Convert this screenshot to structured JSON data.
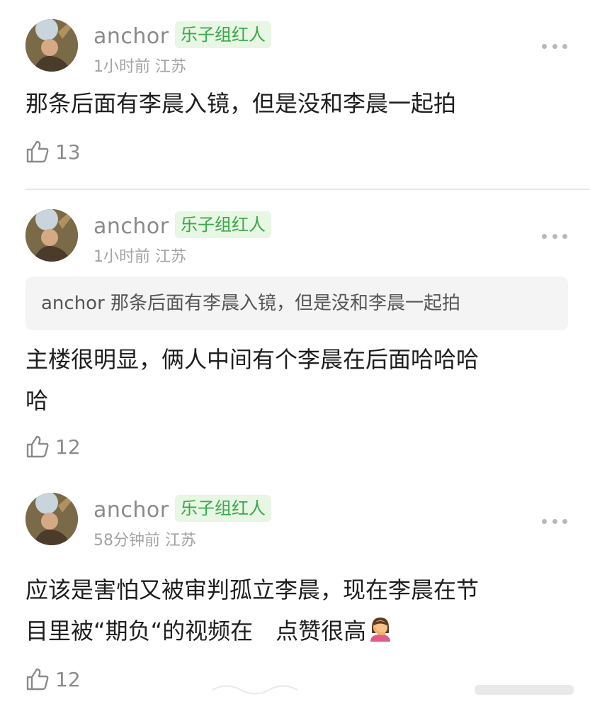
{
  "comments": [
    {
      "username": "anchor",
      "badge": "乐子组红人",
      "meta": "1小时前 江苏",
      "text": "那条后面有李晨入镜，但是没和李晨一起拍",
      "likes": "13"
    },
    {
      "username": "anchor",
      "badge": "乐子组红人",
      "meta": "1小时前 江苏",
      "quote": "anchor 那条后面有李晨入镜，但是没和李晨一起拍",
      "text_line1": "主楼很明显，俩人中间有个李晨在后面哈哈哈",
      "text_line2": "哈",
      "likes": "12"
    },
    {
      "username": "anchor",
      "badge": "乐子组红人",
      "meta": "58分钟前 江苏",
      "text_line1": "应该是害怕又被审判孤立李晨，现在李晨在节",
      "text_line2": "目里被“期负“的视频在　点赞很高",
      "likes": "12"
    }
  ],
  "icons": {
    "like": "thumbs-up-outline-icon",
    "more": "more-dots-icon",
    "emoji": "facepalm-woman-emoji"
  },
  "colors": {
    "badge_bg": "#e8f6e4",
    "badge_text": "#3aa84a",
    "meta": "#a3a3a3",
    "username": "#8a8a8a"
  }
}
